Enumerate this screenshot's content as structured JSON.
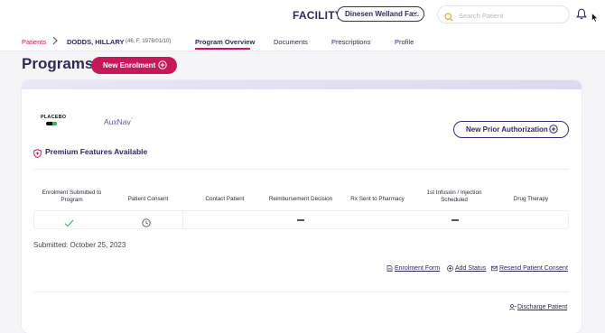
{
  "header": {
    "facility_label": "FACILITY",
    "facility_selected": "Dinesen Welland Fa...",
    "search_placeholder": "Search Patient"
  },
  "breadcrumb": {
    "patients": "Patients",
    "patient_name": "DODDS, HILLARY",
    "patient_meta": "(46, F, 1978/01/10)"
  },
  "tabs": [
    {
      "label": "Program Overview",
      "active": true
    },
    {
      "label": "Documents",
      "active": false
    },
    {
      "label": "Prescriptions",
      "active": false
    },
    {
      "label": "Profile",
      "active": false
    }
  ],
  "page": {
    "title": "Programs",
    "new_enrolment_label": "New Enrolment"
  },
  "program_card": {
    "logos": {
      "placebo": "PLACEBO",
      "auxnav": "AuxNav",
      "auxnav_mark": "*"
    },
    "prior_auth_label": "New Prior Authorization",
    "premium_label": "Premium Features Available",
    "steps": [
      {
        "label": "Enrolment Submitted to Program",
        "status": "complete",
        "icon": "check-icon"
      },
      {
        "label": "Patient Consent",
        "status": "pending",
        "icon": "clock-icon"
      },
      {
        "label": "Contact Patient",
        "status": "none",
        "icon": ""
      },
      {
        "label": "Reimbursement Decision",
        "status": "not-applicable",
        "icon": "dash-icon"
      },
      {
        "label": "Rx Sent to Pharmacy",
        "status": "none",
        "icon": ""
      },
      {
        "label": "1st Infusion / Injection Scheduled",
        "status": "not-applicable",
        "icon": "dash-icon"
      },
      {
        "label": "Drug Therapy",
        "status": "none",
        "icon": ""
      }
    ],
    "submitted_text": "Submitted: October 25, 2023",
    "actions": {
      "enrolment_form": "Enrolment Form",
      "add_status": "Add Status",
      "resend_consent": "Resend Patient Consent"
    },
    "discharge_label": "Discharge Patient"
  },
  "colors": {
    "primary": "#c8185c",
    "navy": "#2d2a5a",
    "success": "#3bb26a"
  }
}
